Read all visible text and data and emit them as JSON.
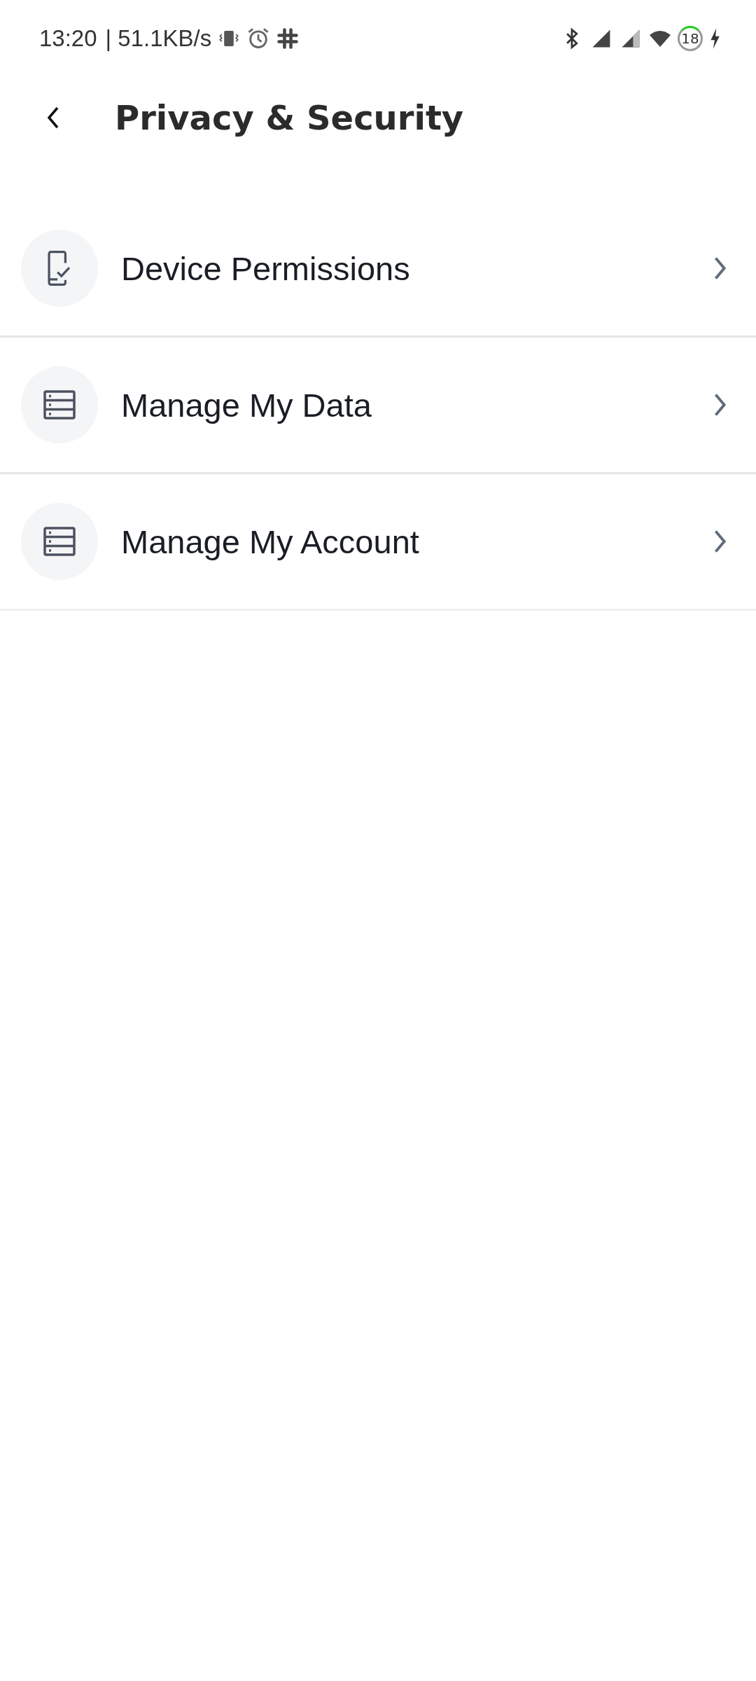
{
  "status_bar": {
    "time": "13:20",
    "speed": "| 51.1KB/s",
    "battery": "18"
  },
  "header": {
    "title": "Privacy & Security"
  },
  "items": [
    {
      "kind": "device",
      "label": "Device Permissions"
    },
    {
      "kind": "list",
      "label": "Manage My Data"
    },
    {
      "kind": "list",
      "label": "Manage My Account"
    }
  ]
}
